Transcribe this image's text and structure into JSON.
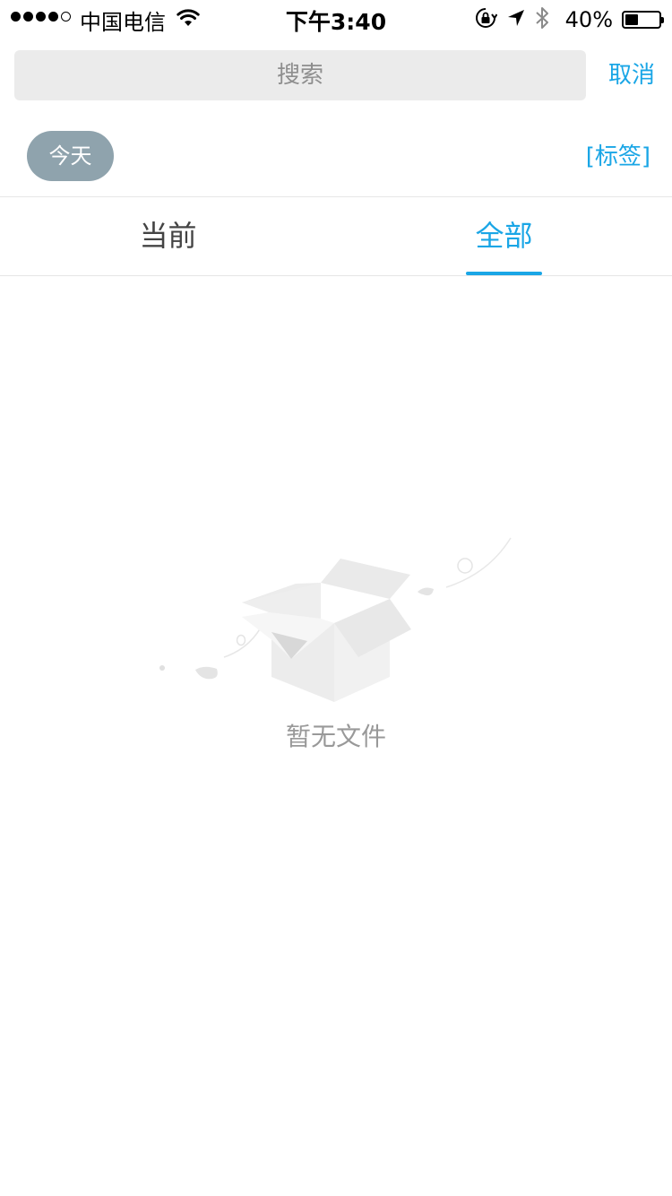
{
  "status_bar": {
    "carrier": "中国电信",
    "time": "下午3:40",
    "battery_percent": "40%",
    "battery_level": 0.4,
    "signal_bars_filled": 4,
    "signal_bars_total": 5,
    "icons": [
      "wifi-icon",
      "rotation-lock-icon",
      "location-arrow-icon",
      "bluetooth-icon",
      "battery-icon"
    ]
  },
  "search": {
    "placeholder": "搜索",
    "value": "",
    "cancel_label": "取消"
  },
  "filter": {
    "today_label": "今天",
    "tags_label": "[标签]"
  },
  "tabs": [
    {
      "label": "当前",
      "active": false
    },
    {
      "label": "全部",
      "active": true
    }
  ],
  "empty_state": {
    "message": "暂无文件",
    "icon": "empty-box-icon"
  },
  "colors": {
    "accent": "#1aa6e6",
    "chip_background": "#8fa3ad",
    "search_background": "#ebebeb",
    "muted_text": "#999999"
  }
}
